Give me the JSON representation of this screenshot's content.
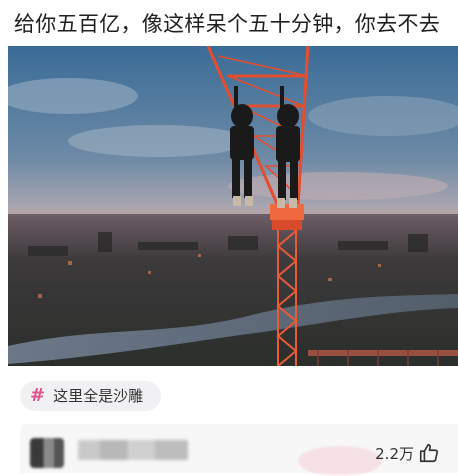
{
  "post": {
    "title": "给你五百亿，像这样呆个五十分钟，你去不去"
  },
  "tag": {
    "icon": "hashtag-icon",
    "hash": "#",
    "text": "这里全是沙雕",
    "accent": "#e0508e"
  },
  "comment_bar": {
    "like_count": "2.2万",
    "like_icon": "thumbs-up-icon"
  },
  "colors": {
    "crane": "#e8502e",
    "sky_top": "#3c6f9a",
    "horizon": "#d9a08a"
  }
}
